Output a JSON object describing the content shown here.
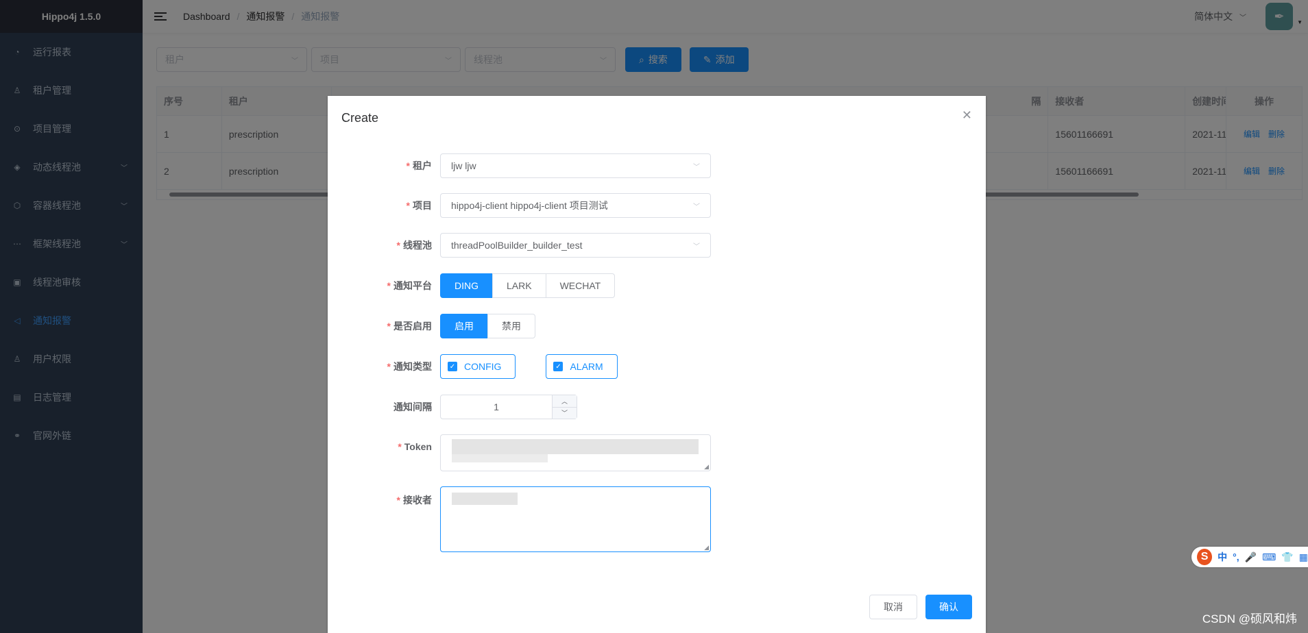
{
  "app": {
    "title": "Hippo4j 1.5.0"
  },
  "sidebar": {
    "items": [
      {
        "label": "运行报表",
        "icon": "dashboard-icon",
        "glyph": "◔",
        "has_arrow": false,
        "active": false
      },
      {
        "label": "租户管理",
        "icon": "user-icon",
        "glyph": "♙",
        "has_arrow": false,
        "active": false
      },
      {
        "label": "项目管理",
        "icon": "project-icon",
        "glyph": "⊙",
        "has_arrow": false,
        "active": false
      },
      {
        "label": "动态线程池",
        "icon": "dynamic-pool-icon",
        "glyph": "◈",
        "has_arrow": true,
        "active": false
      },
      {
        "label": "容器线程池",
        "icon": "container-pool-icon",
        "glyph": "⬡",
        "has_arrow": true,
        "active": false
      },
      {
        "label": "框架线程池",
        "icon": "framework-pool-icon",
        "glyph": "⋯",
        "has_arrow": true,
        "active": false
      },
      {
        "label": "线程池审核",
        "icon": "audit-icon",
        "glyph": "▣",
        "has_arrow": false,
        "active": false
      },
      {
        "label": "通知报警",
        "icon": "alarm-icon",
        "glyph": "◁",
        "has_arrow": false,
        "active": true
      },
      {
        "label": "用户权限",
        "icon": "permission-icon",
        "glyph": "♙",
        "has_arrow": false,
        "active": false
      },
      {
        "label": "日志管理",
        "icon": "log-icon",
        "glyph": "▤",
        "has_arrow": false,
        "active": false
      },
      {
        "label": "官网外链",
        "icon": "link-icon",
        "glyph": "⚭",
        "has_arrow": false,
        "active": false
      }
    ]
  },
  "navbar": {
    "breadcrumb": [
      "Dashboard",
      "通知报警",
      "通知报警"
    ],
    "language": "简体中文"
  },
  "filters": {
    "tenant_placeholder": "租户",
    "project_placeholder": "项目",
    "pool_placeholder": "线程池",
    "search_label": "搜索",
    "add_label": "添加"
  },
  "table": {
    "headers": [
      "序号",
      "租户",
      "",
      "接收者",
      "创建时间",
      "操作"
    ],
    "header_fragment": "隔",
    "rows": [
      {
        "index": "1",
        "tenant": "prescription",
        "receiver": "15601166691",
        "created": "2021-11-"
      },
      {
        "index": "2",
        "tenant": "prescription",
        "receiver": "15601166691",
        "created": "2021-11-"
      }
    ],
    "edit_label": "编辑",
    "delete_label": "删除"
  },
  "dialog": {
    "title": "Create",
    "labels": {
      "tenant": "租户",
      "project": "项目",
      "pool": "线程池",
      "platform": "通知平台",
      "enabled": "是否启用",
      "type": "通知类型",
      "interval": "通知间隔",
      "token": "Token",
      "receiver": "接收者"
    },
    "values": {
      "tenant": "ljw ljw",
      "project": "hippo4j-client hippo4j-client 项目测试",
      "pool": "threadPoolBuilder_builder_test",
      "interval": "1"
    },
    "platform_options": [
      "DING",
      "LARK",
      "WECHAT"
    ],
    "platform_selected": "DING",
    "enabled_options": [
      "启用",
      "禁用"
    ],
    "enabled_selected": "启用",
    "type_options": [
      "CONFIG",
      "ALARM"
    ],
    "cancel_label": "取消",
    "confirm_label": "确认"
  },
  "ime": {
    "logo": "S",
    "glyphs": [
      "中",
      "°,",
      "🎤",
      "⌨",
      "👕",
      "▦"
    ]
  },
  "watermark": "CSDN @硕风和炜",
  "colors": {
    "primary": "#1890ff",
    "sidebar": "#304156",
    "required": "#f56c6c"
  }
}
